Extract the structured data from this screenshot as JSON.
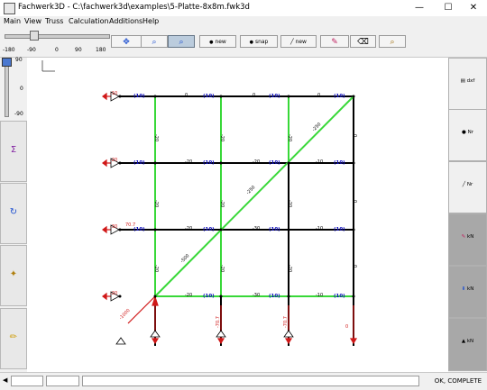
{
  "window": {
    "title": "Fachwerk3D - C:\\fachwerk3d\\examples\\5-Platte-8x8m.fwk3d",
    "minimize": "—",
    "maximize": "☐",
    "close": "✕"
  },
  "menu": {
    "items": [
      "Main",
      "View",
      "Truss",
      "Calculation",
      "Additions",
      "Help"
    ]
  },
  "toolbar": {
    "slider_ticks": [
      "-180",
      "-90",
      "0",
      "90",
      "180"
    ],
    "buttons": [
      {
        "icon": "move-icon",
        "glyph": "✥",
        "label": ""
      },
      {
        "icon": "zoom-out-icon",
        "glyph": "⌕",
        "label": ""
      },
      {
        "icon": "zoom-in-icon",
        "glyph": "⌕",
        "label": ""
      },
      {
        "icon": "new-node-icon",
        "glyph": "●",
        "label": "new"
      },
      {
        "icon": "snap-node-icon",
        "glyph": "●",
        "label": "snap"
      },
      {
        "icon": "new-member-icon",
        "glyph": "╱",
        "label": "new"
      },
      {
        "icon": "edit-pen-icon",
        "glyph": "✎",
        "label": ""
      },
      {
        "icon": "delete-icon",
        "glyph": "⌫",
        "label": ""
      },
      {
        "icon": "zoom-view-icon",
        "glyph": "⌕",
        "label": ""
      }
    ]
  },
  "left_slider": {
    "top": "90",
    "middle": "0",
    "bottom": "-90"
  },
  "left_buttons": [
    {
      "name": "sum-icon",
      "glyph": "Σ"
    },
    {
      "name": "rotate-icon",
      "glyph": "↻"
    },
    {
      "name": "select-cursor-icon",
      "glyph": "✦"
    },
    {
      "name": "pencil-icon",
      "glyph": "✏"
    }
  ],
  "right_buttons": [
    {
      "name": "dxf-export-icon",
      "label": "dxf",
      "glyph": "▤"
    },
    {
      "name": "node-number-icon",
      "label": "Nr",
      "glyph": "●"
    },
    {
      "name": "member-number-icon",
      "label": "Nr",
      "glyph": "╱"
    },
    {
      "name": "member-force-icon",
      "label": "kN",
      "glyph": "✎"
    },
    {
      "name": "load-icon",
      "label": "kN",
      "glyph": "⬇"
    },
    {
      "name": "support-reaction-icon",
      "label": "kN",
      "glyph": "▲"
    }
  ],
  "colors": {
    "green_member": "#38d838",
    "black_member": "#000000",
    "red_force": "#d01818",
    "blue_label": "#1010c0"
  },
  "canvas": {
    "top_labels": [
      {
        "value": "(10)"
      },
      {
        "value": "(10)"
      },
      {
        "value": "(10)"
      }
    ],
    "row_labels": [
      {
        "value": "(10)"
      },
      {
        "value": "(10)"
      },
      {
        "value": "(10)"
      }
    ],
    "diagonal_labels": [
      "-500",
      "-250",
      "-250"
    ],
    "reaction_labels": [
      "-1000",
      "-70.7",
      "-70.7"
    ]
  },
  "status": {
    "text": "OK, COMPLETE"
  }
}
